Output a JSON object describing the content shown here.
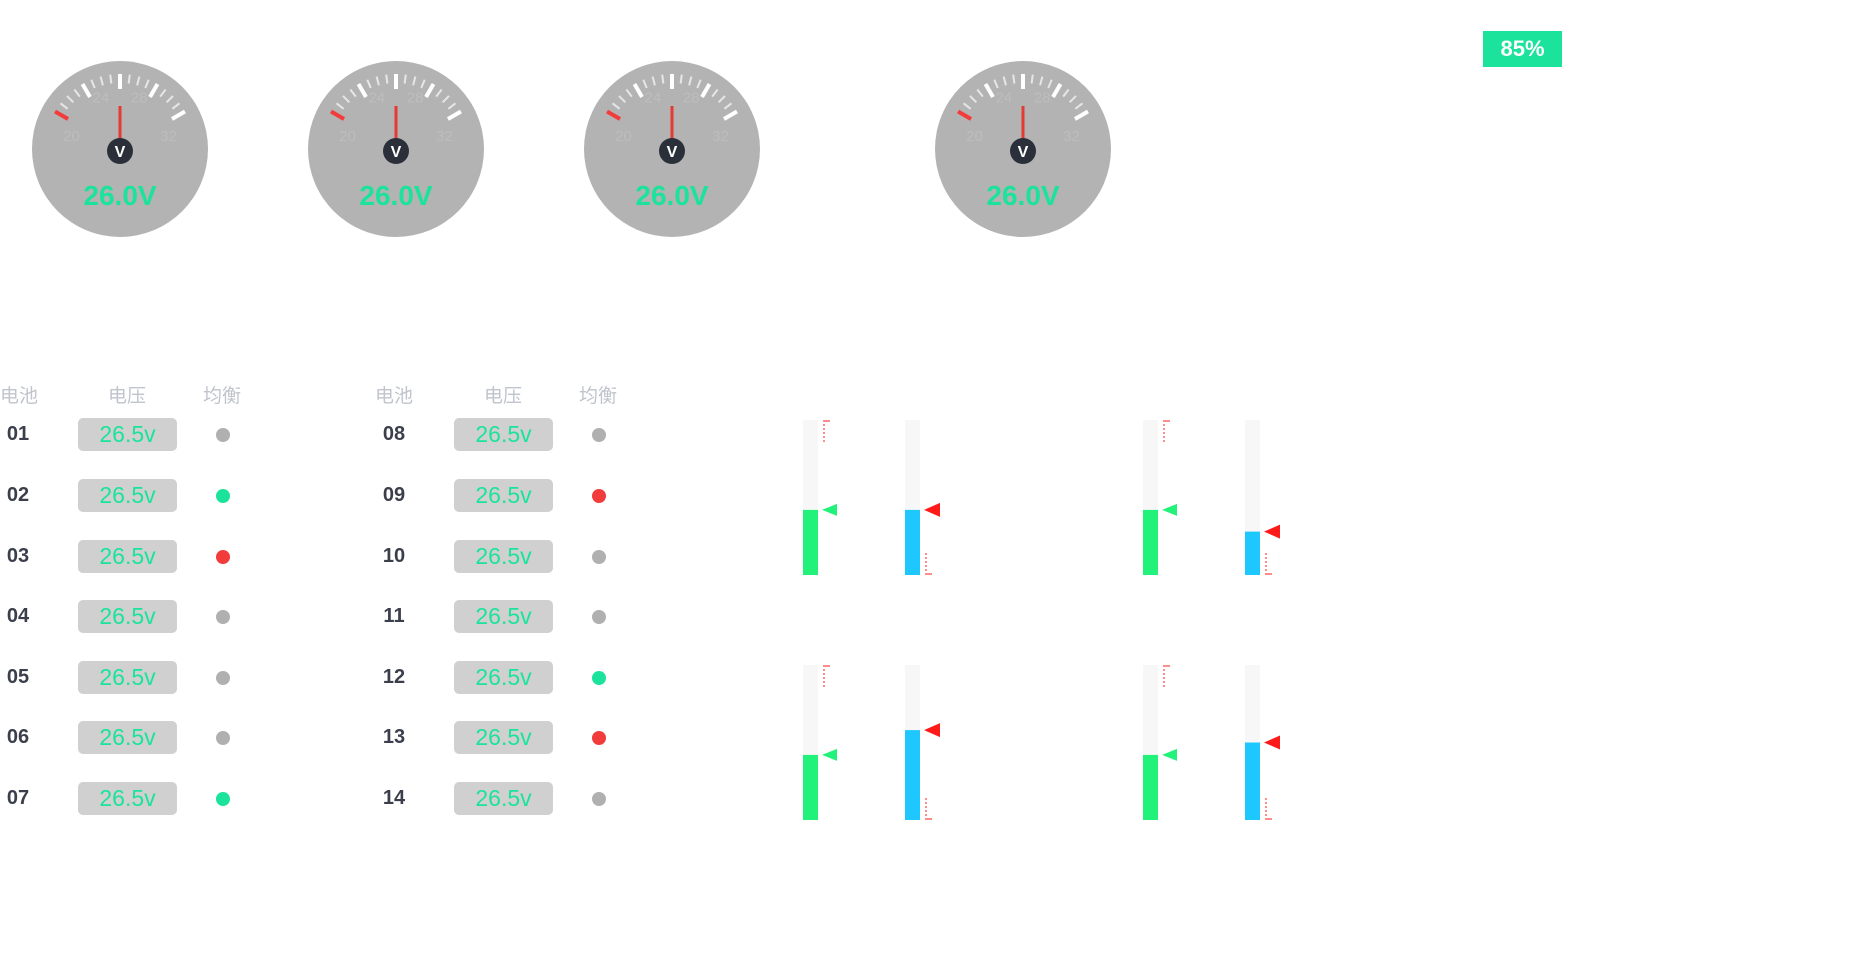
{
  "percent_badge": "85%",
  "gauges": [
    {
      "reading": "26.0V",
      "unit_icon": "V",
      "ticks": [
        "20",
        "24",
        "28",
        "32"
      ]
    },
    {
      "reading": "26.0V",
      "unit_icon": "V",
      "ticks": [
        "20",
        "24",
        "28",
        "32"
      ]
    },
    {
      "reading": "26.0V",
      "unit_icon": "V",
      "ticks": [
        "20",
        "24",
        "28",
        "32"
      ]
    },
    {
      "reading": "26.0V",
      "unit_icon": "V",
      "ticks": [
        "20",
        "24",
        "28",
        "32"
      ]
    }
  ],
  "battery_table": {
    "headers": {
      "cell": "电池",
      "voltage": "电压",
      "balance": "均衡"
    },
    "left": [
      {
        "id": "01",
        "voltage": "26.5v",
        "status": "idle"
      },
      {
        "id": "02",
        "voltage": "26.5v",
        "status": "balancing"
      },
      {
        "id": "03",
        "voltage": "26.5v",
        "status": "alarm"
      },
      {
        "id": "04",
        "voltage": "26.5v",
        "status": "idle"
      },
      {
        "id": "05",
        "voltage": "26.5v",
        "status": "idle"
      },
      {
        "id": "06",
        "voltage": "26.5v",
        "status": "idle"
      },
      {
        "id": "07",
        "voltage": "26.5v",
        "status": "balancing"
      }
    ],
    "right": [
      {
        "id": "08",
        "voltage": "26.5v",
        "status": "idle"
      },
      {
        "id": "09",
        "voltage": "26.5v",
        "status": "alarm"
      },
      {
        "id": "10",
        "voltage": "26.5v",
        "status": "idle"
      },
      {
        "id": "11",
        "voltage": "26.5v",
        "status": "idle"
      },
      {
        "id": "12",
        "voltage": "26.5v",
        "status": "balancing"
      },
      {
        "id": "13",
        "voltage": "26.5v",
        "status": "alarm"
      },
      {
        "id": "14",
        "voltage": "26.5v",
        "status": "idle"
      }
    ]
  },
  "status_colors": {
    "idle": "#b0b0b0",
    "balancing": "#1be39b",
    "alarm": "#f23b3b"
  },
  "colors": {
    "accent": "#1be39b",
    "gauge_face": "#b3b3b3",
    "needle": "#e53935",
    "green_bar": "#23f27a",
    "blue_bar": "#1ec8ff",
    "marker_red": "#ff1a1a"
  },
  "level_bars": [
    {
      "green_level": 0.42,
      "blue_level": 0.42
    },
    {
      "green_level": 0.42,
      "blue_level": 0.28
    },
    {
      "green_level": 0.42,
      "blue_level": 0.58
    },
    {
      "green_level": 0.42,
      "blue_level": 0.5
    }
  ]
}
